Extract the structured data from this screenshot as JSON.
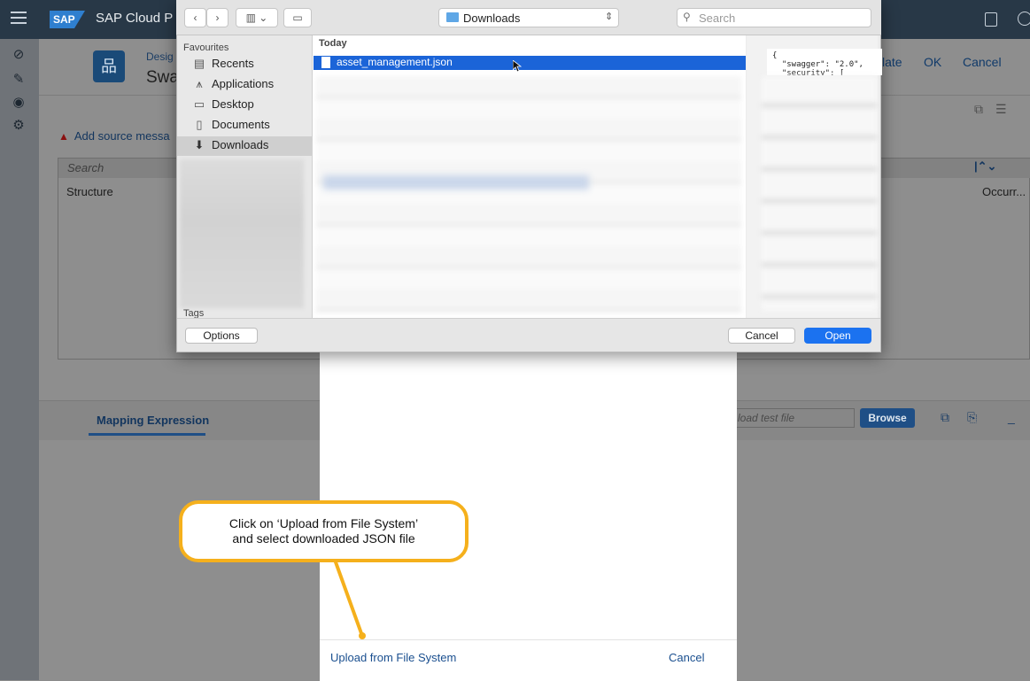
{
  "shell": {
    "title": "SAP Cloud P",
    "logo": "SAP"
  },
  "left_nav": {
    "icons": [
      "discover-icon",
      "design-pencil-icon",
      "monitor-eye-icon",
      "settings-gears-icon"
    ]
  },
  "background_app": {
    "object_subtitle": "Desig",
    "object_title": "Swa",
    "header_actions": [
      "late",
      "OK",
      "Cancel"
    ],
    "warning_text": "Add source messa",
    "search_placeholder": "Search",
    "columns": {
      "structure": "Structure",
      "occurrence": "Occurr..."
    },
    "mapping_tab": "Mapping Expression",
    "test_file_placeholder": "load test file",
    "browse_label": "Browse"
  },
  "file_dialog": {
    "location": "Downloads",
    "search_placeholder": "Search",
    "sidebar": {
      "favourites_title": "Favourites",
      "items": [
        {
          "label": "Recents",
          "icon": "recents-icon"
        },
        {
          "label": "Applications",
          "icon": "applications-icon"
        },
        {
          "label": "Desktop",
          "icon": "desktop-icon"
        },
        {
          "label": "Documents",
          "icon": "documents-icon"
        },
        {
          "label": "Downloads",
          "icon": "downloads-icon",
          "selected": true
        }
      ],
      "tags_title": "Tags"
    },
    "list": {
      "section": "Today",
      "selected_file": "asset_management.json"
    },
    "preview_text": "{\n  \"swagger\": \"2.0\",\n  \"security\": [",
    "buttons": {
      "options": "Options",
      "cancel": "Cancel",
      "open": "Open"
    },
    "accent_color": "#1b64d8"
  },
  "upload_panel": {
    "upload_link": "Upload from File System",
    "cancel": "Cancel"
  },
  "callout": {
    "line1": "Click on ‘Upload from File System’",
    "line2": "and select downloaded JSON file",
    "border_color": "#f5b01c"
  }
}
